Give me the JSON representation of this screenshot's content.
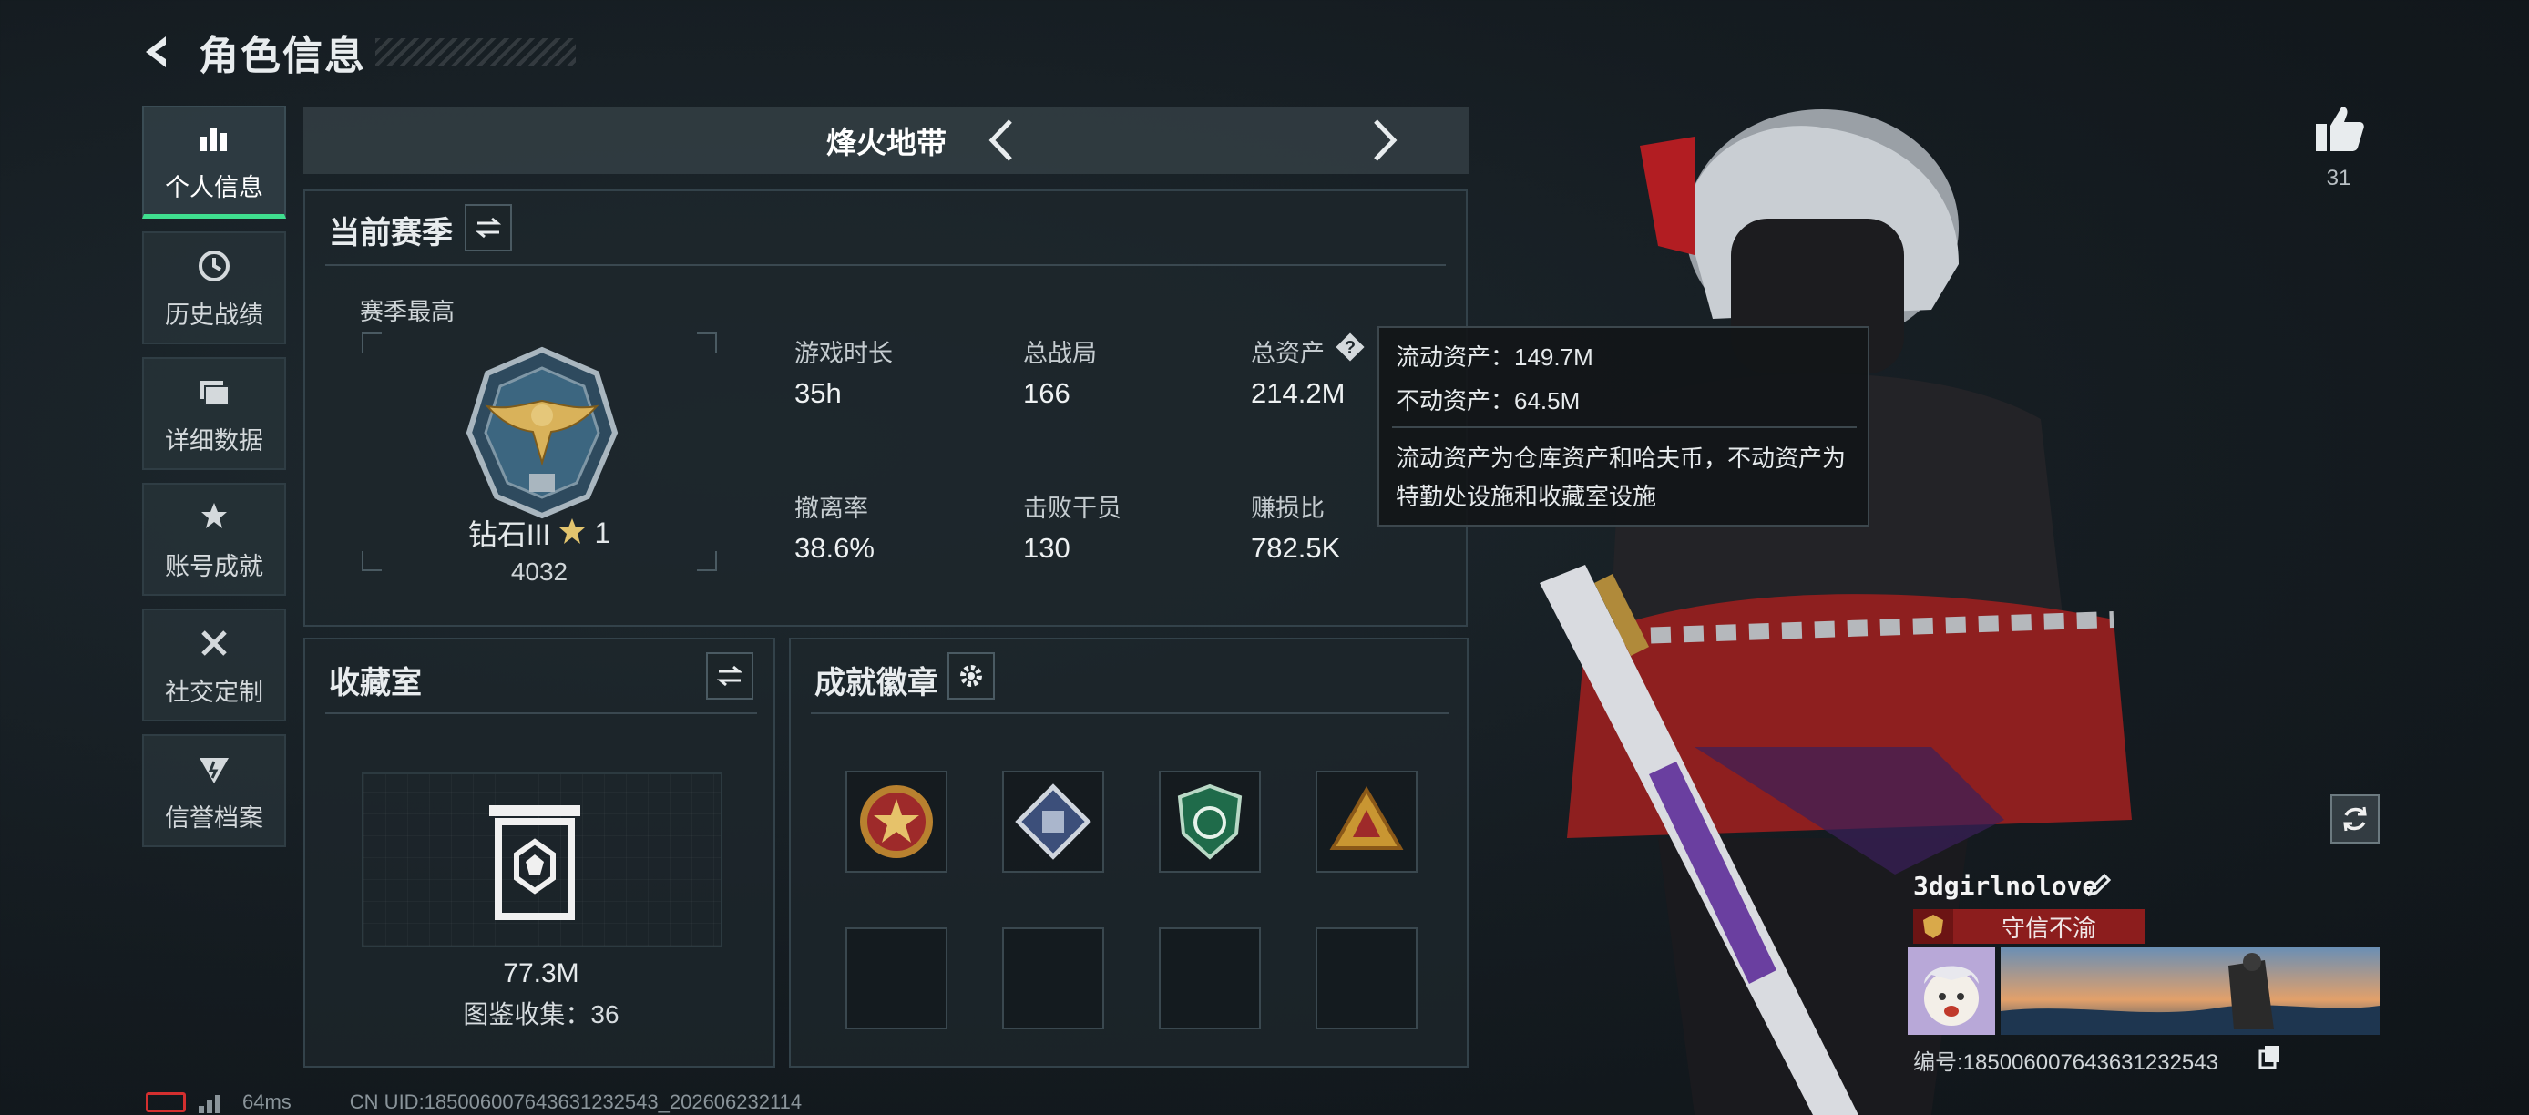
{
  "header": {
    "title": "角色信息"
  },
  "nav": {
    "items": [
      {
        "label": "个人信息",
        "icon": "bar-chart-icon",
        "active": true
      },
      {
        "label": "历史战绩",
        "icon": "clock-history-icon",
        "active": false
      },
      {
        "label": "详细数据",
        "icon": "folder-icon",
        "active": false
      },
      {
        "label": "账号成就",
        "icon": "achievement-icon",
        "active": false
      },
      {
        "label": "社交定制",
        "icon": "tools-icon",
        "active": false
      },
      {
        "label": "信誉档案",
        "icon": "shield-credit-icon",
        "active": false
      }
    ]
  },
  "mode": {
    "label": "烽火地带"
  },
  "season": {
    "title": "当前赛季",
    "best_label": "赛季最高",
    "rank_name": "钻石III",
    "rank_stars": "1",
    "rank_score": "4032",
    "stats": [
      {
        "label": "游戏时长",
        "value": "35h"
      },
      {
        "label": "总战局",
        "value": "166"
      },
      {
        "label": "总资产",
        "value": "214.2M"
      },
      {
        "label": "撤离率",
        "value": "38.6%"
      },
      {
        "label": "击败干员",
        "value": "130"
      },
      {
        "label": "赚损比",
        "value": "782.5K"
      }
    ]
  },
  "tooltip": {
    "line1": "流动资产：149.7M",
    "line2": "不动资产：64.5M",
    "note": "流动资产为仓库资产和哈夫币，不动资产为特勤处设施和收藏室设施"
  },
  "collection": {
    "title": "收藏室",
    "value": "77.3M",
    "count_text": "图鉴收集：36"
  },
  "badges": {
    "title": "成就徽章",
    "slots": [
      "red-star-badge",
      "blue-diamond-badge",
      "green-shield-badge",
      "gold-triangle-badge",
      "",
      "",
      "",
      ""
    ]
  },
  "likes": {
    "count": "31"
  },
  "player": {
    "name": "3dgirlnolove",
    "tag": "守信不渝",
    "id_text": "编号:185006007643631232543"
  },
  "footer": {
    "ping": "64ms",
    "uid": "CN UID:185006007643631232543_202606232114"
  },
  "colors": {
    "accent": "#3fdf8f",
    "tag_red": "#8c1d1d",
    "panel": "#1e272c"
  }
}
